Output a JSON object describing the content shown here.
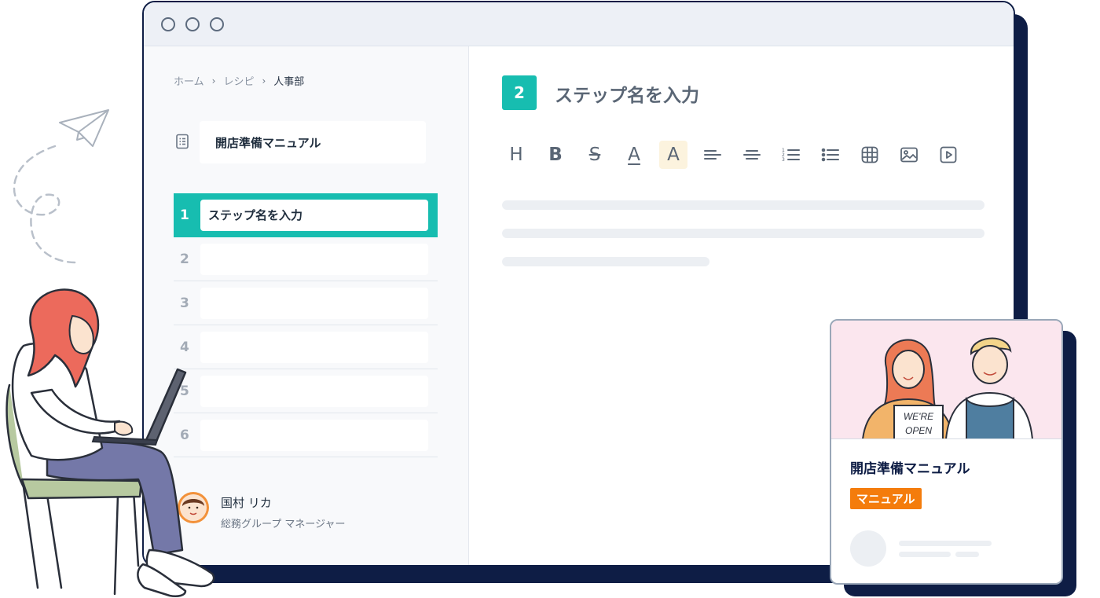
{
  "breadcrumb": {
    "home": "ホーム",
    "recipe": "レシピ",
    "current": "人事部"
  },
  "manual": {
    "title": "開店準備マニュアル"
  },
  "steps": [
    {
      "number": "1",
      "name": "ステップ名を入力"
    },
    {
      "number": "2",
      "name": ""
    },
    {
      "number": "3",
      "name": ""
    },
    {
      "number": "4",
      "name": ""
    },
    {
      "number": "5",
      "name": ""
    },
    {
      "number": "6",
      "name": ""
    }
  ],
  "user": {
    "name": "国村 リカ",
    "role": "総務グループ マネージャー"
  },
  "editor": {
    "step_number": "2",
    "step_title": "ステップ名を入力",
    "toolbar": {
      "heading": "H",
      "bold": "B",
      "strike": "S",
      "font_color": "A",
      "highlight": "A"
    }
  },
  "card": {
    "title": "開店準備マニュアル",
    "tag": "マニュアル",
    "sign_line1": "WE'RE",
    "sign_line2": "OPEN"
  },
  "colors": {
    "accent": "#17bdb0",
    "navy": "#0e1d45",
    "tag": "#f47c0c"
  }
}
